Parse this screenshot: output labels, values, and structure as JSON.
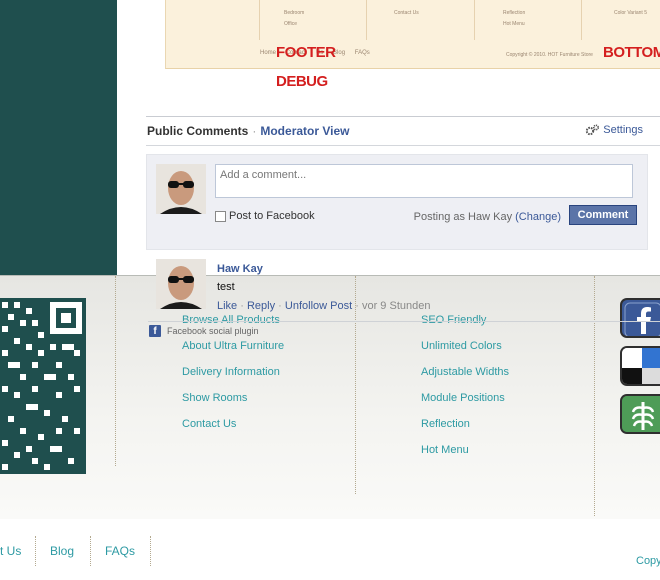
{
  "preview": {
    "col1_item1": "Bedroom",
    "col1_item2": "Office",
    "col2_item1": "Contact Us",
    "col3_item1": "Reflection",
    "col3_item2": "Hot Menu",
    "col4_item1": "Color Variant 5",
    "links": [
      "Home",
      "Contact Us",
      "Blog",
      "FAQs"
    ],
    "copyright": "Copyright © 2010. HOT Furniture Store"
  },
  "debug_labels": {
    "footer": "FOOTER",
    "debug": "DEBUG",
    "bottom": "BOTTOM"
  },
  "facebook": {
    "tab_public": "Public Comments",
    "tab_separator": "·",
    "tab_moderator": "Moderator View",
    "settings": "Settings",
    "comment_placeholder": "Add a comment...",
    "post_to_facebook": "Post to Facebook",
    "posting_as_prefix": "Posting as Haw Kay",
    "change": "(Change)",
    "comment_button": "Comment",
    "post": {
      "author": "Haw Kay",
      "text": "test",
      "like": "Like",
      "reply": "Reply",
      "unfollow": "Unfollow Post",
      "time": "vor 9 Stunden"
    },
    "plugin_label": "Facebook social plugin",
    "brand_color": "#3b5998"
  },
  "footer": {
    "col1": [
      "Browse All Products",
      "About Ultra Furniture",
      "Delivery Information",
      "Show Rooms",
      "Contact Us"
    ],
    "col2": [
      "SEO Friendly",
      "Unlimited Colors",
      "Adjustable Widths",
      "Module Positions",
      "Reflection",
      "Hot Menu"
    ],
    "social_icons": [
      "facebook-icon",
      "delicious-icon",
      "evernote-icon"
    ]
  },
  "bottom_nav": {
    "contact": "t Us",
    "blog": "Blog",
    "faqs": "FAQs",
    "copyright": "Copy"
  },
  "colors": {
    "teal_band": "#1f4f4e",
    "link_teal": "#2d9aa3",
    "debug_red": "#d41f1f"
  }
}
